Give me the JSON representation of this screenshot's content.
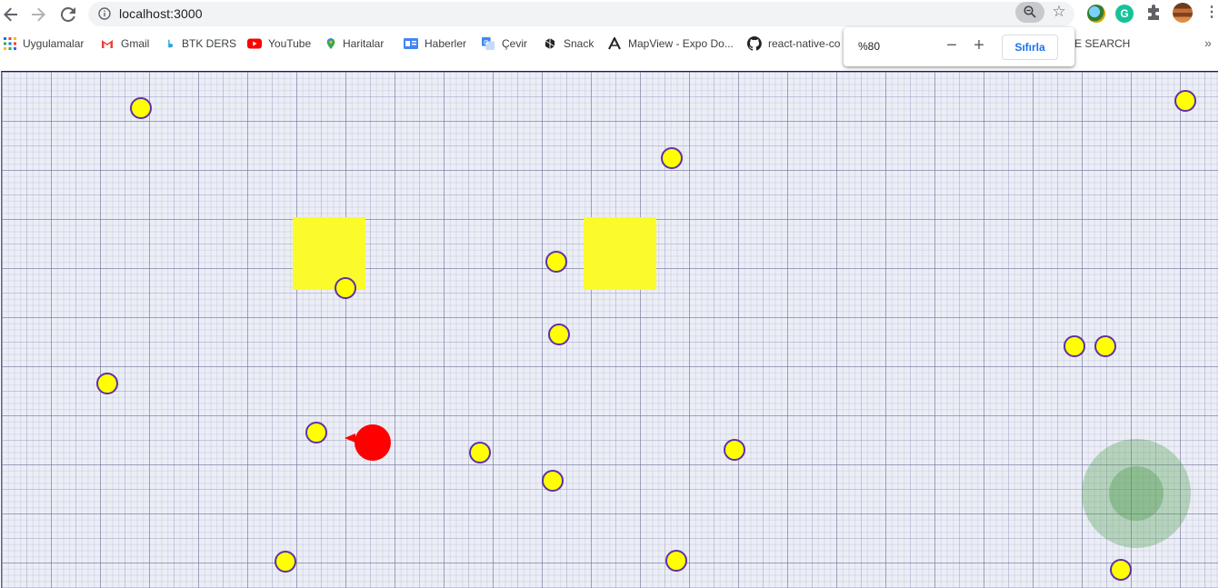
{
  "browser": {
    "url": "localhost:3000",
    "icons": {
      "back": "arrow-left-icon",
      "forward": "arrow-right-icon",
      "reload": "reload-icon",
      "site_info": "info-icon",
      "zoom": "zoom-icon",
      "bookmark": "star-icon",
      "menu": "kebab-menu-icon"
    }
  },
  "bookmarks": [
    {
      "label": "Uygulamalar",
      "icon": "apps-grid-icon"
    },
    {
      "label": "Gmail",
      "icon": "gmail-icon"
    },
    {
      "label": "BTK DERS",
      "icon": "btk-icon"
    },
    {
      "label": "YouTube",
      "icon": "youtube-icon"
    },
    {
      "label": "Haritalar",
      "icon": "maps-pin-icon"
    },
    {
      "label": "Haberler",
      "icon": "news-icon"
    },
    {
      "label": "Çevir",
      "icon": "translate-icon"
    },
    {
      "label": "Snack",
      "icon": "snack-icon"
    },
    {
      "label": "MapView - Expo Do...",
      "icon": "expo-icon"
    },
    {
      "label": "react-native-co",
      "icon": "github-icon"
    },
    {
      "label": "E SEARCH",
      "icon": ""
    }
  ],
  "zoom_popup": {
    "level": "%80",
    "minus": "−",
    "plus": "+",
    "reset": "Sıfırla"
  },
  "game": {
    "colors": {
      "background": "#eceef6",
      "coin_fill": "#ffff00",
      "coin_border": "#5b32a6",
      "block": "#fbfb2b",
      "player": "#ff0000",
      "joystick": "#50a050"
    }
  }
}
